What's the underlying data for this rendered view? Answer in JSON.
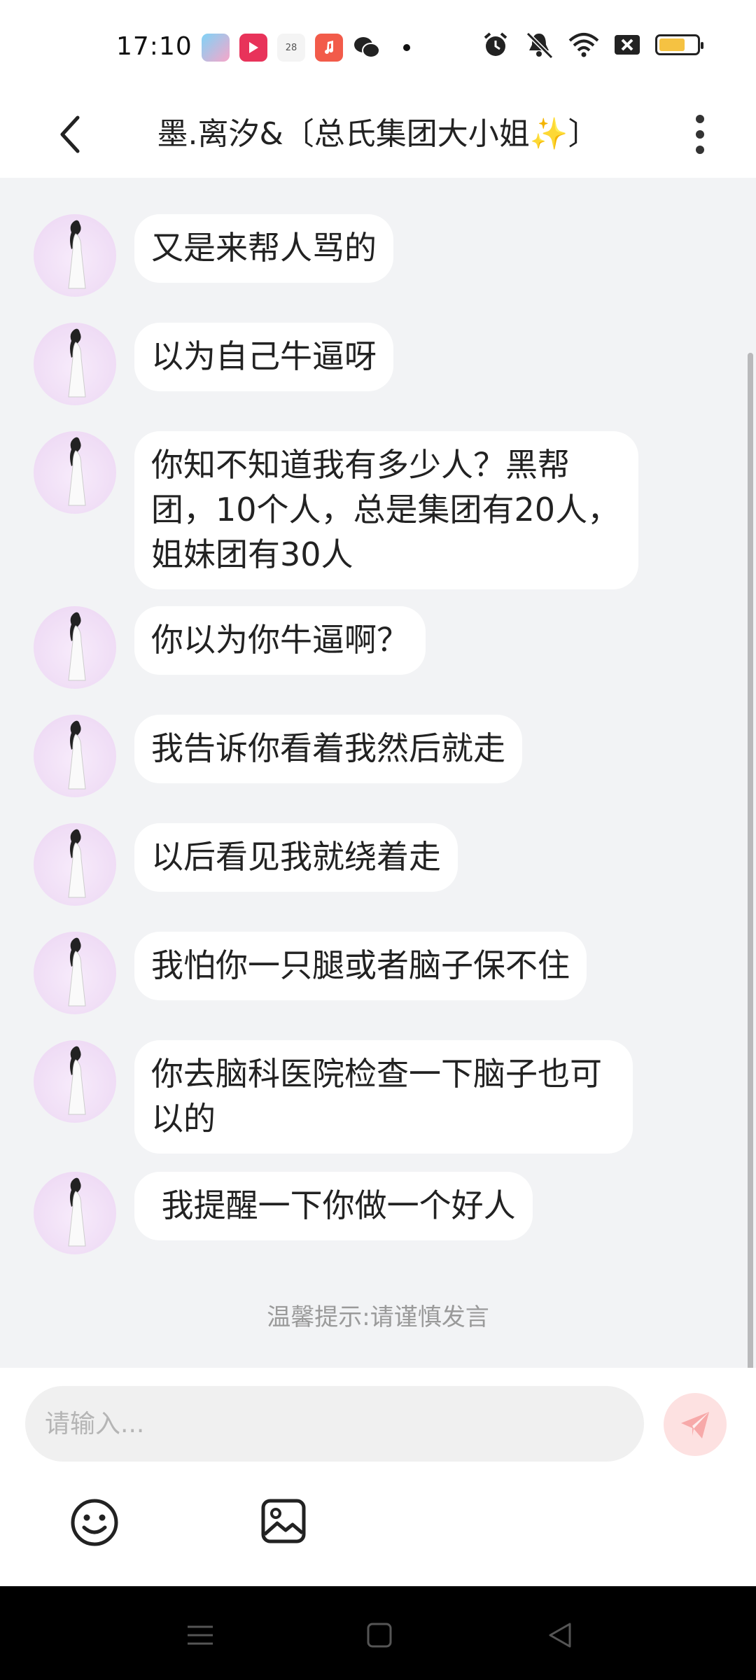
{
  "status_bar": {
    "time": "17:10",
    "calendar_day": "28",
    "icons": [
      "game-app-icon",
      "video-app-icon",
      "calendar-icon",
      "music-app-icon",
      "wechat-icon",
      "alarm-icon",
      "mute-icon",
      "wifi-icon",
      "sim-off-icon",
      "battery-icon"
    ],
    "battery_level": 0.7,
    "battery_color": "#f5c242"
  },
  "header": {
    "title": "墨.离汐&〔总氏集团大小姐✨〕",
    "back_icon": "chevron-left-icon",
    "more_icon": "more-vertical-icon"
  },
  "messages": [
    {
      "text": "又是来帮人骂的"
    },
    {
      "text": "以为自己牛逼呀"
    },
    {
      "text": "你知不知道我有多少人？黑帮团，10个人，总是集团有20人，姐妹团有30人"
    },
    {
      "text": "你以为你牛逼啊？"
    },
    {
      "text": "我告诉你看着我然后就走"
    },
    {
      "text": "以后看见我就绕着走"
    },
    {
      "text": "我怕你一只腿或者脑子保不住"
    },
    {
      "text": "你去脑科医院检查一下脑子也可以的"
    },
    {
      "text": " 我提醒一下你做一个好人"
    }
  ],
  "hint": "温馨提示:请谨慎发言",
  "composer": {
    "placeholder": "请输入...",
    "value": "",
    "send_icon": "send-icon",
    "emoji_icon": "emoji-icon",
    "image_icon": "image-icon",
    "send_color": "#f26a6a"
  },
  "nav": {
    "icons": [
      "menu-icon",
      "home-icon",
      "back-icon"
    ]
  },
  "colors": {
    "chat_background": "#f2f3f5",
    "bubble": "#ffffff",
    "hint_text": "#9a9a9a"
  }
}
